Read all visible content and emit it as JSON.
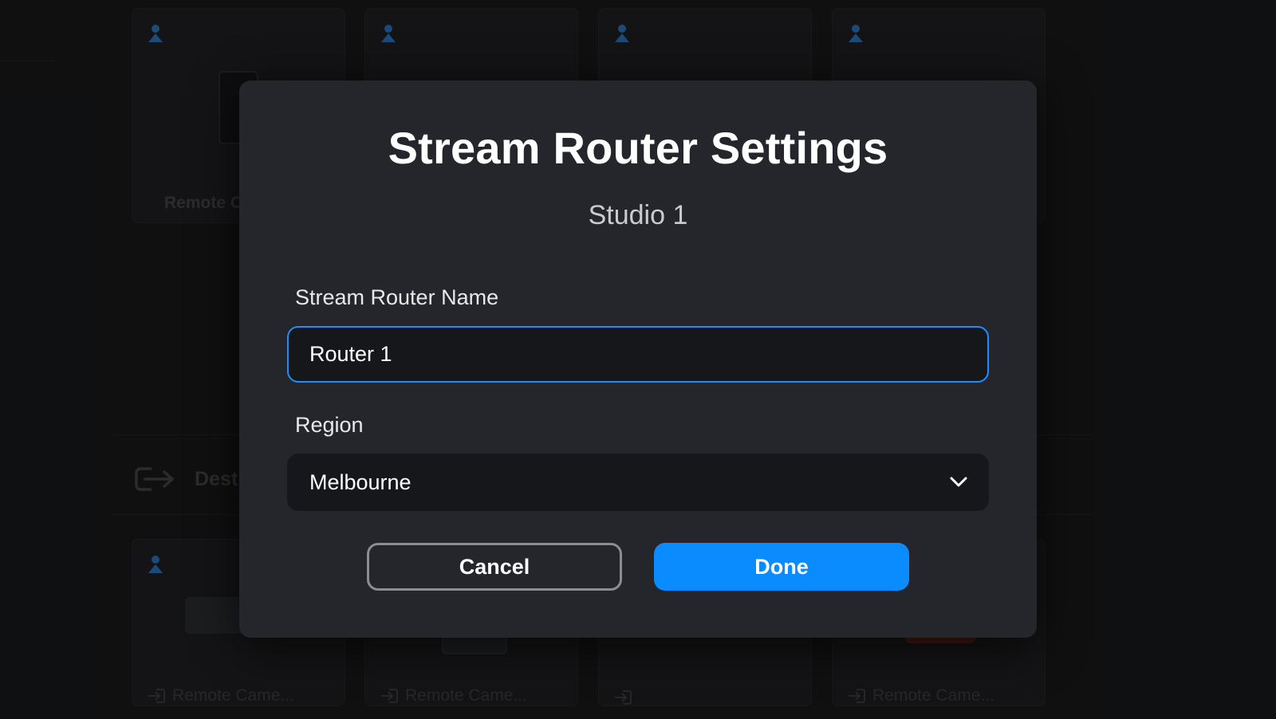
{
  "background": {
    "top_cards": [
      {
        "label": "Remote C"
      },
      {
        "label": ""
      },
      {
        "label": ""
      },
      {
        "label": ""
      }
    ],
    "destinations_label": "Dest",
    "bottom_cards": [
      {
        "label": "Remote Came..."
      },
      {
        "label": "Remote Came..."
      },
      {
        "label": ""
      },
      {
        "label": "Remote Came..."
      }
    ]
  },
  "modal": {
    "title": "Stream Router Settings",
    "subtitle": "Studio 1",
    "name_field": {
      "label": "Stream Router Name",
      "value": "Router 1"
    },
    "region_field": {
      "label": "Region",
      "value": "Melbourne"
    },
    "cancel_label": "Cancel",
    "done_label": "Done"
  },
  "colors": {
    "accent": "#0a8cff",
    "person_icon": "#2b7fd4",
    "modal_bg": "#24262b"
  },
  "icons": [
    "person-icon",
    "destination-output-icon",
    "chevron-down-icon",
    "input-icon"
  ]
}
